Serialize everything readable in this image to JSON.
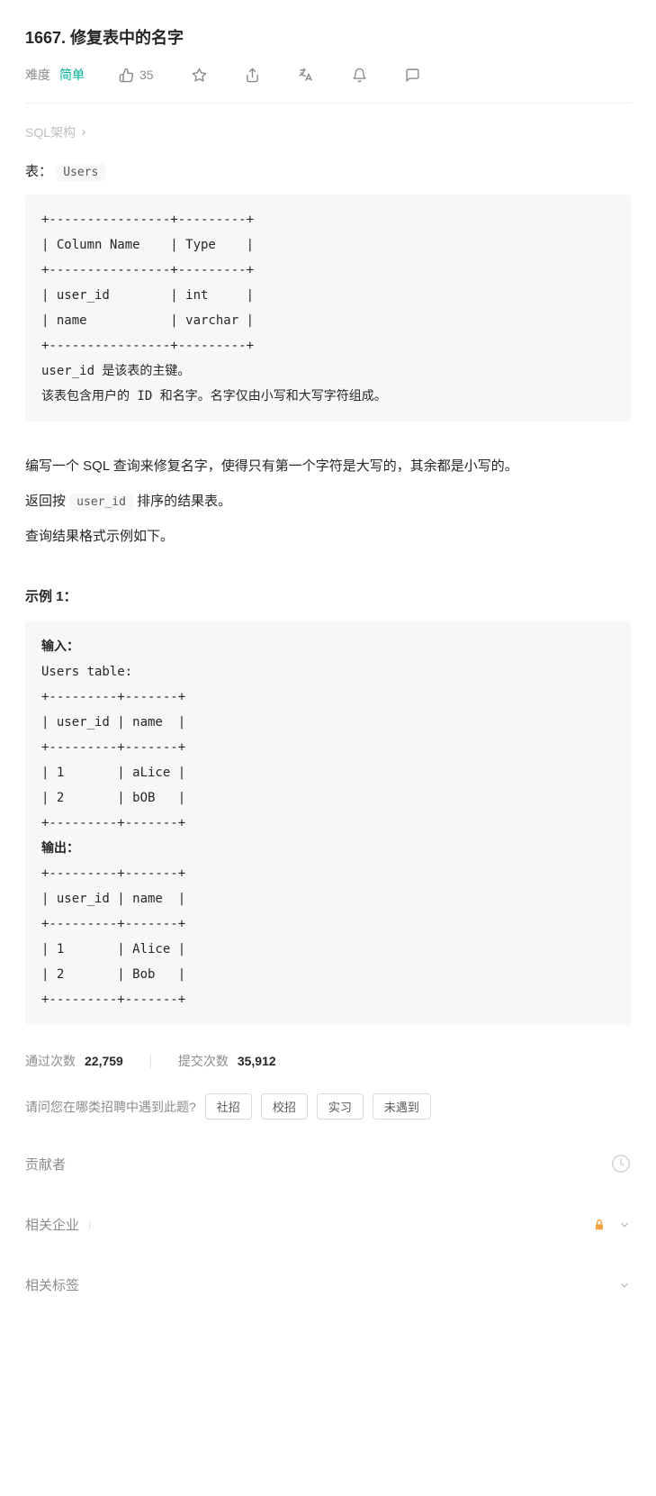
{
  "title": "1667. 修复表中的名字",
  "toolbar": {
    "difficulty_label": "难度",
    "difficulty_value": "简单",
    "likes": "35"
  },
  "sql_link": "SQL架构",
  "table_intro_prefix": "表：",
  "table_name": "Users",
  "schema_block": "+----------------+---------+\n| Column Name    | Type    |\n+----------------+---------+\n| user_id        | int     |\n| name           | varchar |\n+----------------+---------+\nuser_id 是该表的主键。\n该表包含用户的 ID 和名字。名字仅由小写和大写字符组成。",
  "para1": "编写一个 SQL 查询来修复名字，使得只有第一个字符是大写的，其余都是小写的。",
  "para2_prefix": "返回按 ",
  "para2_code": "user_id",
  "para2_suffix": " 排序的结果表。",
  "para3": "查询结果格式示例如下。",
  "example_heading": "示例 1：",
  "example_input_label": "输入：",
  "example_users_label": "Users table:",
  "example_output_label": "输出：",
  "example_block_part1": "+---------+-------+\n| user_id | name  |\n+---------+-------+\n| 1       | aLice |\n| 2       | bOB   |\n+---------+-------+",
  "example_block_part2": "+---------+-------+\n| user_id | name  |\n+---------+-------+\n| 1       | Alice |\n| 2       | Bob   |\n+---------+-------+",
  "stats": {
    "pass_label": "通过次数",
    "pass_value": "22,759",
    "submit_label": "提交次数",
    "submit_value": "35,912"
  },
  "tag_question": "请问您在哪类招聘中遇到此题?",
  "tags": [
    "社招",
    "校招",
    "实习",
    "未遇到"
  ],
  "accordion1": "贡献者",
  "accordion2": "相关企业",
  "accordion3": "相关标签",
  "chart_data": {
    "type": "table",
    "title": "Users schema",
    "columns": [
      "Column Name",
      "Type"
    ],
    "rows": [
      [
        "user_id",
        "int"
      ],
      [
        "name",
        "varchar"
      ]
    ],
    "example_input": {
      "columns": [
        "user_id",
        "name"
      ],
      "rows": [
        [
          1,
          "aLice"
        ],
        [
          2,
          "bOB"
        ]
      ]
    },
    "example_output": {
      "columns": [
        "user_id",
        "name"
      ],
      "rows": [
        [
          1,
          "Alice"
        ],
        [
          2,
          "Bob"
        ]
      ]
    }
  }
}
